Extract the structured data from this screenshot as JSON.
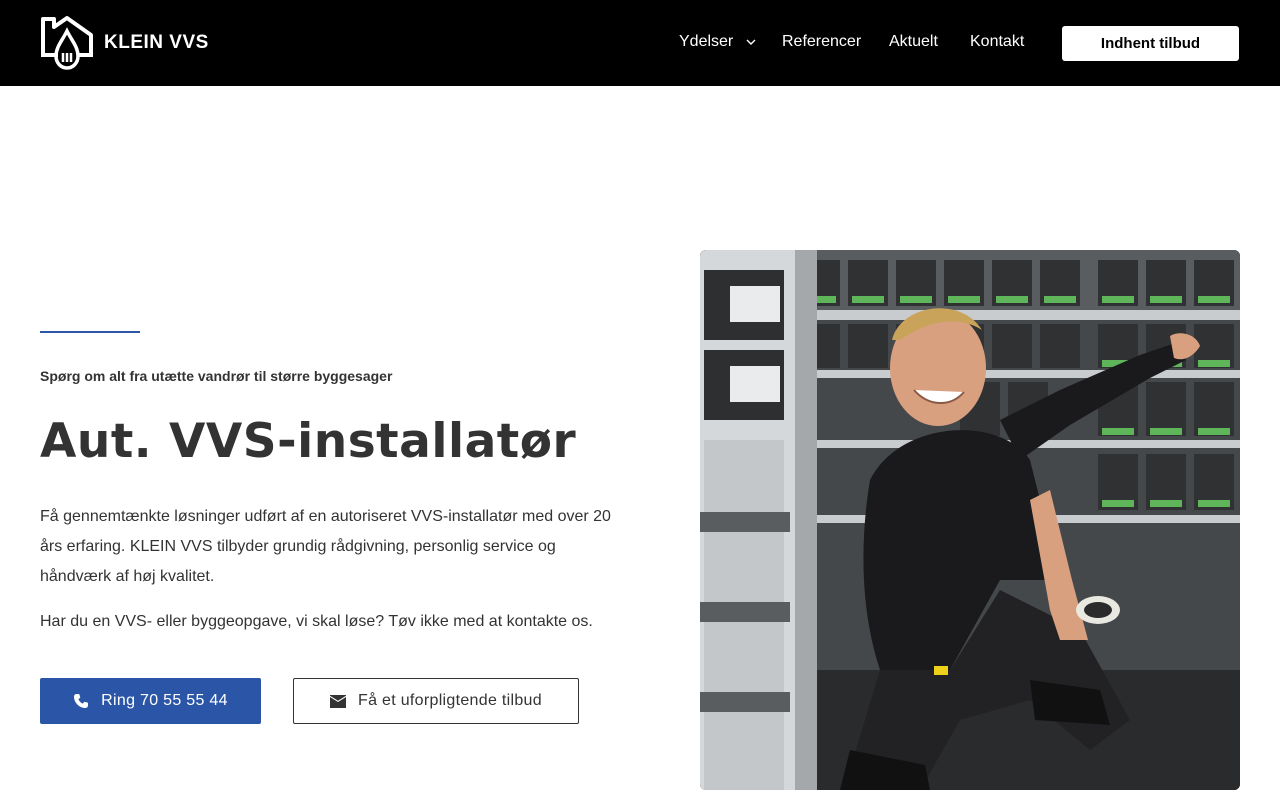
{
  "header": {
    "logo_text": "KLEIN VVS",
    "nav": [
      {
        "label": "Ydelser",
        "has_dropdown": true
      },
      {
        "label": "Referencer"
      },
      {
        "label": "Aktuelt"
      },
      {
        "label": "Kontakt"
      }
    ],
    "cta_label": "Indhent tilbud",
    "background": "#000000"
  },
  "hero": {
    "kicker": "Spørg om alt fra utætte vandrør til større byggesager",
    "title": "Aut. VVS-installatør",
    "paragraph1": "Få gennemtænkte løsninger udført af en autoriseret VVS-installatør med over 20 års erfaring. KLEIN VVS tilbyder grundig rådgivning, personlig service og håndværk af høj kvalitet.",
    "paragraph2": "Har du en VVS- eller byggeopgave, vi skal løse? Tøv ikke med at kontakte os.",
    "primary_button": {
      "label": "Ring 70 55 55 44",
      "icon": "phone-icon"
    },
    "secondary_button": {
      "label": "Få et uforpligtende tilbud",
      "icon": "envelope-icon"
    },
    "accent_color": "#2b56a8"
  },
  "photo": {
    "icon": "plumber-photo"
  }
}
